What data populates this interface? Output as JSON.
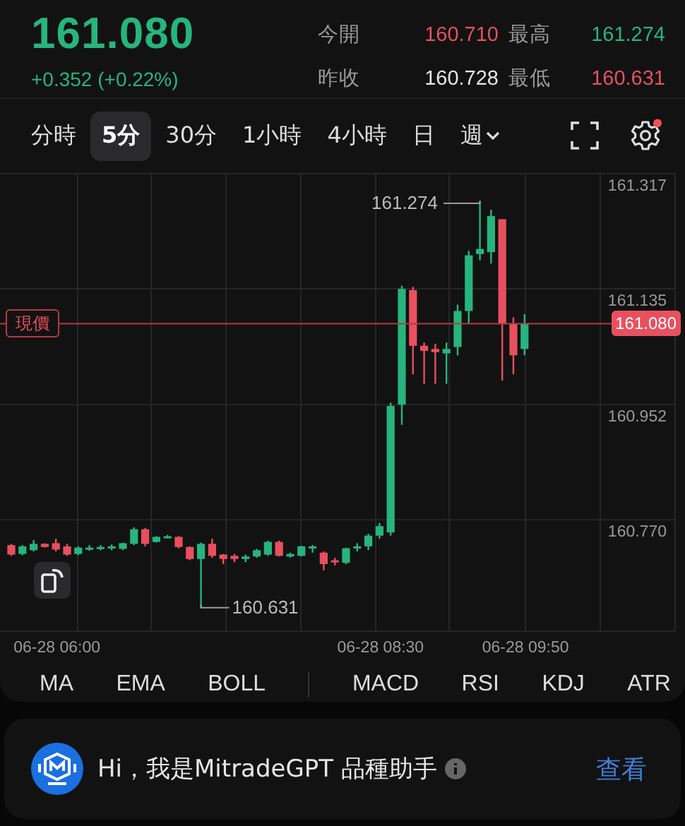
{
  "quote": {
    "price": "161.080",
    "change": "+0.352 (+0.22%)",
    "color": "#27b47e"
  },
  "stats": [
    {
      "label": "今開",
      "value": "160.710",
      "color": "#e8505f"
    },
    {
      "label": "最高",
      "value": "161.274",
      "color": "#27b47e"
    },
    {
      "label": "昨收",
      "value": "160.728",
      "color": "#e6e6e6"
    },
    {
      "label": "最低",
      "value": "160.631",
      "color": "#e8505f"
    }
  ],
  "timeframes": [
    {
      "label": "分時",
      "selected": false,
      "kind": "plain"
    },
    {
      "label": "5分",
      "selected": true,
      "kind": "plain"
    },
    {
      "label": "30分",
      "selected": false,
      "kind": "plain"
    },
    {
      "label": "1小時",
      "selected": false,
      "kind": "plain"
    },
    {
      "label": "4小時",
      "selected": false,
      "kind": "plain"
    },
    {
      "label": "日",
      "selected": false,
      "kind": "plain"
    },
    {
      "label": "週",
      "selected": false,
      "kind": "menu"
    }
  ],
  "settings_badge": true,
  "chart": {
    "current_price": {
      "tag": "現價",
      "value": "161.080"
    },
    "high_marker": "161.274",
    "low_marker": "160.631",
    "chart_data": {
      "type": "candlestick",
      "categories": [
        null,
        null,
        null,
        null,
        "06-28 06:00",
        null,
        null,
        null,
        null,
        null,
        null,
        null,
        null,
        null,
        null,
        null,
        null,
        null,
        null,
        null,
        null,
        null,
        null,
        null,
        null,
        null,
        null,
        null,
        null,
        null,
        null,
        null,
        null,
        "06-28 08:30",
        null,
        null,
        null,
        null,
        null,
        null,
        null,
        null,
        null,
        null,
        null,
        null,
        "06-28 09:50"
      ],
      "yticks": [
        {
          "value": 161.317,
          "label": "161.317"
        },
        {
          "value": 161.135,
          "label": "161.135"
        },
        {
          "value": 160.952,
          "label": "160.952"
        },
        {
          "value": 160.77,
          "label": "160.770"
        }
      ],
      "ylim": [
        160.594,
        161.317
      ],
      "grid": true,
      "ref_lines": [
        {
          "axis": "y",
          "value": 161.08,
          "color": "#b33a46"
        }
      ],
      "ohlc": [
        [
          160.73,
          160.732,
          160.713,
          160.715
        ],
        [
          160.716,
          160.73,
          160.714,
          160.728
        ],
        [
          160.722,
          160.738,
          160.72,
          160.732
        ],
        [
          160.732,
          160.733,
          160.726,
          160.727
        ],
        [
          160.733,
          160.74,
          160.72,
          160.723
        ],
        [
          160.728,
          160.732,
          160.713,
          160.715
        ],
        [
          160.716,
          160.728,
          160.714,
          160.726
        ],
        [
          160.724,
          160.73,
          160.721,
          160.726
        ],
        [
          160.725,
          160.73,
          160.722,
          160.727
        ],
        [
          160.725,
          160.731,
          160.722,
          160.728
        ],
        [
          160.724,
          160.734,
          160.722,
          160.733
        ],
        [
          160.732,
          160.758,
          160.73,
          160.755
        ],
        [
          160.755,
          160.757,
          160.728,
          160.732
        ],
        [
          160.735,
          160.744,
          160.734,
          160.743
        ],
        [
          160.743,
          160.746,
          160.742,
          160.744
        ],
        [
          160.743,
          160.744,
          160.725,
          160.727
        ],
        [
          160.727,
          160.728,
          160.706,
          160.708
        ],
        [
          160.708,
          160.734,
          160.631,
          160.732
        ],
        [
          160.732,
          160.74,
          160.71,
          160.713
        ],
        [
          160.715,
          160.716,
          160.7,
          160.708
        ],
        [
          160.713,
          160.716,
          160.703,
          160.708
        ],
        [
          160.708,
          160.715,
          160.703,
          160.712
        ],
        [
          160.712,
          160.724,
          160.71,
          160.722
        ],
        [
          160.715,
          160.737,
          160.713,
          160.735
        ],
        [
          160.735,
          160.737,
          160.712,
          160.713
        ],
        [
          160.712,
          160.718,
          160.71,
          160.716
        ],
        [
          160.713,
          160.729,
          160.712,
          160.728
        ],
        [
          160.727,
          160.73,
          160.718,
          160.728
        ],
        [
          160.718,
          160.72,
          160.69,
          160.7
        ],
        [
          160.706,
          160.71,
          160.698,
          160.703
        ],
        [
          160.702,
          160.726,
          160.7,
          160.725
        ],
        [
          160.725,
          160.733,
          160.72,
          160.728
        ],
        [
          160.728,
          160.748,
          160.722,
          160.745
        ],
        [
          160.745,
          160.765,
          160.74,
          160.76
        ],
        [
          160.75,
          160.955,
          160.745,
          160.95
        ],
        [
          160.952,
          161.14,
          160.92,
          161.135
        ],
        [
          161.133,
          161.138,
          161.0,
          161.045
        ],
        [
          161.045,
          161.05,
          160.985,
          161.037
        ],
        [
          161.04,
          161.048,
          160.985,
          161.035
        ],
        [
          161.033,
          161.05,
          160.985,
          161.04
        ],
        [
          161.043,
          161.11,
          161.03,
          161.1
        ],
        [
          161.1,
          161.195,
          161.08,
          161.188
        ],
        [
          161.19,
          161.274,
          161.18,
          161.198
        ],
        [
          161.193,
          161.26,
          161.175,
          161.25
        ],
        [
          161.245,
          161.245,
          160.99,
          161.08
        ],
        [
          161.08,
          161.09,
          161.0,
          161.03
        ],
        [
          161.04,
          161.095,
          161.03,
          161.08
        ]
      ]
    }
  },
  "indicators": [
    [
      "MA",
      "EMA",
      "BOLL"
    ],
    [
      "MACD",
      "RSI",
      "KDJ",
      "ATR"
    ]
  ],
  "assistant": {
    "message": "Hi，我是MitradeGPT 品種助手",
    "action": "查看"
  }
}
